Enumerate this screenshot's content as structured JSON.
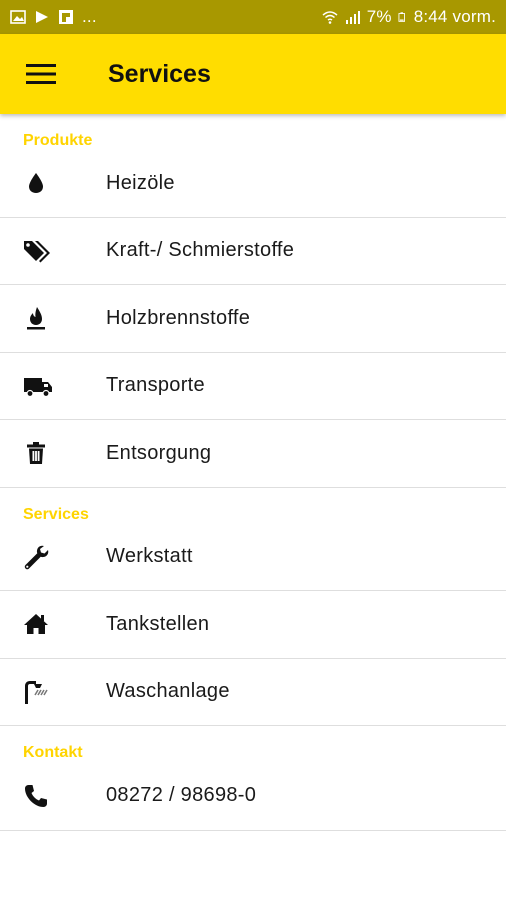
{
  "status_bar": {
    "ellipsis": "...",
    "battery": "7%",
    "time": "8:44 vorm."
  },
  "app_bar": {
    "title": "Services"
  },
  "sections": [
    {
      "header": "Produkte",
      "items": [
        {
          "label": "Heizöle",
          "icon": "drop-icon"
        },
        {
          "label": "Kraft-/ Schmierstoffe",
          "icon": "tags-icon"
        },
        {
          "label": "Holzbrennstoffe",
          "icon": "fire-icon"
        },
        {
          "label": "Transporte",
          "icon": "truck-icon"
        },
        {
          "label": "Entsorgung",
          "icon": "trash-icon"
        }
      ]
    },
    {
      "header": "Services",
      "items": [
        {
          "label": "Werkstatt",
          "icon": "wrench-icon"
        },
        {
          "label": "Tankstellen",
          "icon": "home-icon"
        },
        {
          "label": "Waschanlage",
          "icon": "shower-icon"
        }
      ]
    },
    {
      "header": "Kontakt",
      "items": [
        {
          "label": "08272 / 98698-0",
          "icon": "phone-icon"
        }
      ]
    }
  ],
  "colors": {
    "accent": "#ffdd00",
    "section_header": "#ffd400",
    "status_bar": "#a89800"
  }
}
